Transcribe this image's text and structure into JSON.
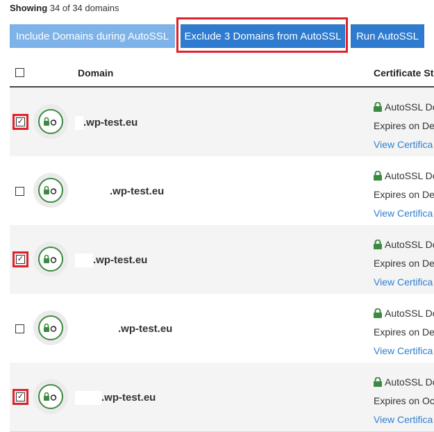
{
  "header": {
    "showing_label": "Showing",
    "showing_count": "34 of 34 domains"
  },
  "buttons": {
    "include": "Include Domains during AutoSSL",
    "exclude": "Exclude 3 Domains from AutoSSL",
    "run": "Run AutoSSL"
  },
  "table": {
    "columns": [
      "Domain",
      "Certificate St"
    ],
    "rows": [
      {
        "domain": ".wp-test.eu",
        "checked": true,
        "cert_status": "AutoSSL Do",
        "expires": "Expires on De",
        "link": "View Certifica"
      },
      {
        "domain": ".wp-test.eu",
        "checked": false,
        "cert_status": "AutoSSL Do",
        "expires": "Expires on De",
        "link": "View Certifica"
      },
      {
        "domain": ".wp-test.eu",
        "checked": true,
        "cert_status": "AutoSSL Do",
        "expires": "Expires on De",
        "link": "View Certifica"
      },
      {
        "domain": ".wp-test.eu",
        "checked": false,
        "cert_status": "AutoSSL Do",
        "expires": "Expires on De",
        "link": "View Certifica"
      },
      {
        "domain": ".wp-test.eu",
        "checked": true,
        "cert_status": "AutoSSL Do",
        "expires": "Expires on Oc",
        "link": "View Certifica"
      }
    ]
  },
  "colors": {
    "primary_button": "#2e7bcf",
    "secondary_button": "#7db3e8",
    "highlight": "#e0202a",
    "lock_green": "#3c8a40",
    "link": "#2f7fcf"
  },
  "icons": {
    "status": "lock-refresh-icon",
    "cert": "lock-icon"
  }
}
